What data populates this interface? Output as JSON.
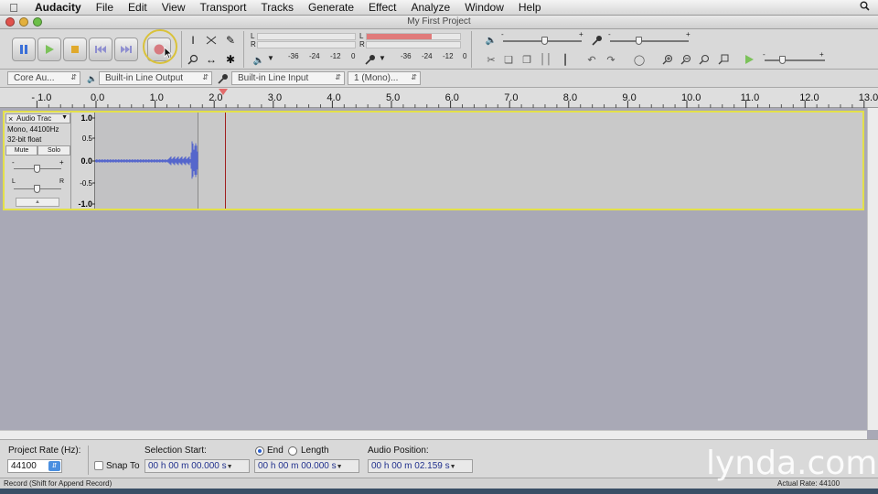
{
  "menubar": {
    "app_name": "Audacity",
    "items": [
      "File",
      "Edit",
      "View",
      "Transport",
      "Tracks",
      "Generate",
      "Effect",
      "Analyze",
      "Window",
      "Help"
    ]
  },
  "window": {
    "title": "My First Project"
  },
  "meters": {
    "playback_ticks": [
      "-36",
      "-24",
      "-12",
      "0"
    ],
    "record_ticks": [
      "-36",
      "-24",
      "-12",
      "0"
    ],
    "lr_left": "L",
    "lr_right": "R",
    "record_level": 0.7
  },
  "mixer": {
    "plus": "+",
    "minus": "-"
  },
  "devices": {
    "host": "Core Au...",
    "output": "Built-in Line Output",
    "input": "Built-in Line Input",
    "channels": "1 (Mono)..."
  },
  "ruler": {
    "labels": [
      "- 1.0",
      "0.0",
      "1.0",
      "2.0",
      "3.0",
      "4.0",
      "5.0",
      "6.0",
      "7.0",
      "8.0",
      "9.0",
      "10.0",
      "11.0",
      "12.0",
      "13.0"
    ],
    "playhead_seconds": 2.159
  },
  "track": {
    "name": "Audio Trac",
    "format": "Mono, 44100Hz",
    "bit_depth": "32-bit float",
    "mute_label": "Mute",
    "solo_label": "Solo",
    "gain_minus": "-",
    "gain_plus": "+",
    "pan_left": "L",
    "pan_right": "R",
    "scale": [
      "1.0",
      "0.5",
      "0.0",
      "-0.5",
      "-1.0"
    ]
  },
  "selection_bar": {
    "project_rate_label": "Project Rate (Hz):",
    "project_rate_value": "44100",
    "snap_to_label": "Snap To",
    "selection_start_label": "Selection Start:",
    "selection_start_value": "00 h 00 m 00.000 s",
    "end_label": "End",
    "length_label": "Length",
    "end_value": "00 h 00 m 00.000 s",
    "audio_position_label": "Audio Position:",
    "audio_position_value": "00 h 00 m 02.159 s"
  },
  "status": {
    "message": "Record (Shift for Append Record)",
    "actual_rate": "Actual Rate: 44100"
  },
  "watermark": "lynda.com",
  "colors": {
    "record_meter": "#e07a7a",
    "waveform": "#5566cc",
    "track_border": "#e3e04a",
    "playhead": "#a02020"
  }
}
